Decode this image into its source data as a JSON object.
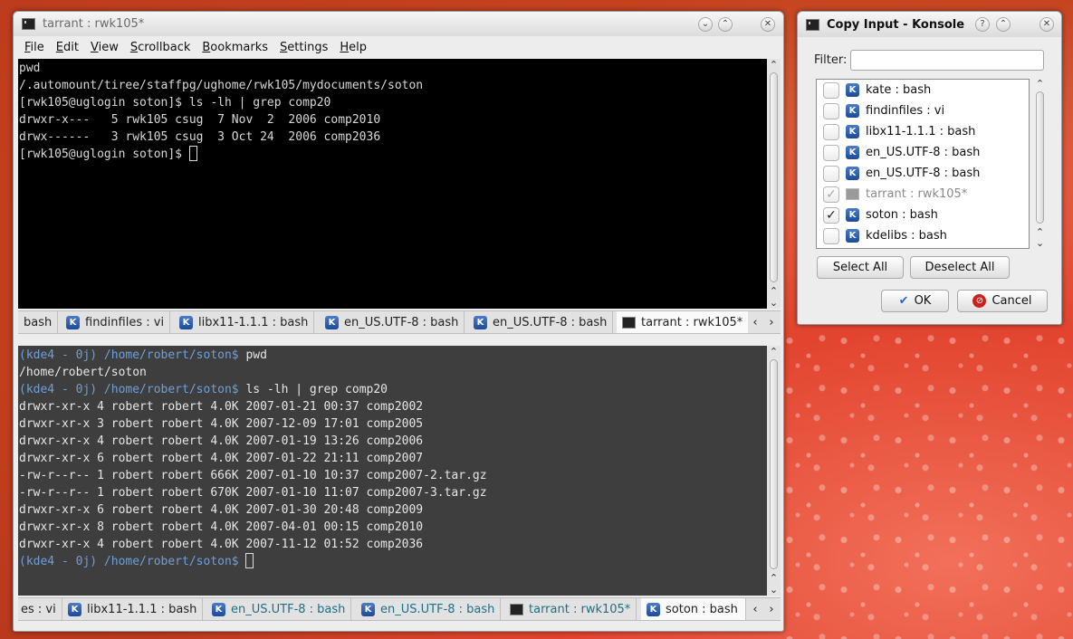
{
  "main_window": {
    "title": "tarrant : rwk105*",
    "menu": [
      "File",
      "Edit",
      "View",
      "Scrollback",
      "Bookmarks",
      "Settings",
      "Help"
    ],
    "top_terminal": {
      "lines": [
        "pwd",
        "/.automount/tiree/staffpg/ughome/rwk105/mydocuments/soton",
        "[rwk105@uglogin soton]$ ls -lh | grep comp20",
        "drwxr-x---   5 rwk105 csug  7 Nov  2  2006 comp2010",
        "drwx------   3 rwk105 csug  3 Oct 24  2006 comp2036"
      ],
      "prompt": "[rwk105@uglogin soton]$ "
    },
    "top_tabs": [
      "bash",
      "findinfiles : vi",
      "libx11-1.1.1 : bash",
      "en_US.UTF-8 : bash",
      "en_US.UTF-8 : bash",
      "tarrant : rwk105*"
    ],
    "bottom_terminal": {
      "prompt": "(kde4 - 0j) /home/robert/soton$",
      "cmd1": " pwd",
      "out1": "/home/robert/soton",
      "cmd2": " ls -lh | grep comp20",
      "lines": [
        "drwxr-xr-x 4 robert robert 4.0K 2007-01-21 00:37 comp2002",
        "drwxr-xr-x 3 robert robert 4.0K 2007-12-09 17:01 comp2005",
        "drwxr-xr-x 4 robert robert 4.0K 2007-01-19 13:26 comp2006",
        "drwxr-xr-x 6 robert robert 4.0K 2007-01-22 21:11 comp2007",
        "-rw-r--r-- 1 robert robert 666K 2007-01-10 10:37 comp2007-2.tar.gz",
        "-rw-r--r-- 1 robert robert 670K 2007-01-10 11:07 comp2007-3.tar.gz",
        "drwxr-xr-x 6 robert robert 4.0K 2007-01-30 20:48 comp2009",
        "drwxr-xr-x 8 robert robert 4.0K 2007-04-01 00:15 comp2010",
        "drwxr-xr-x 4 robert robert 4.0K 2007-11-12 01:52 comp2036"
      ]
    },
    "bottom_tabs": [
      "es : vi",
      "libx11-1.1.1 : bash",
      "en_US.UTF-8 : bash",
      "en_US.UTF-8 : bash",
      "tarrant : rwk105*",
      "soton : bash"
    ]
  },
  "dialog": {
    "title": "Copy Input - Konsole",
    "filter_label": "Filter:",
    "filter_value": "",
    "items": [
      {
        "label": "kate : bash",
        "checked": false
      },
      {
        "label": "findinfiles : vi",
        "checked": false
      },
      {
        "label": "libx11-1.1.1 : bash",
        "checked": false
      },
      {
        "label": "en_US.UTF-8 : bash",
        "checked": false
      },
      {
        "label": "en_US.UTF-8 : bash",
        "checked": false
      },
      {
        "label": "tarrant : rwk105*",
        "checked": true
      },
      {
        "label": "soton : bash",
        "checked": true
      },
      {
        "label": "kdelibs : bash",
        "checked": false
      }
    ],
    "select_all": "Select All",
    "deselect_all": "Deselect All",
    "ok": "OK",
    "cancel": "Cancel"
  },
  "colors": {
    "prompt_blue": "#6f9fd8",
    "activity_tab": "#1d6f84"
  }
}
